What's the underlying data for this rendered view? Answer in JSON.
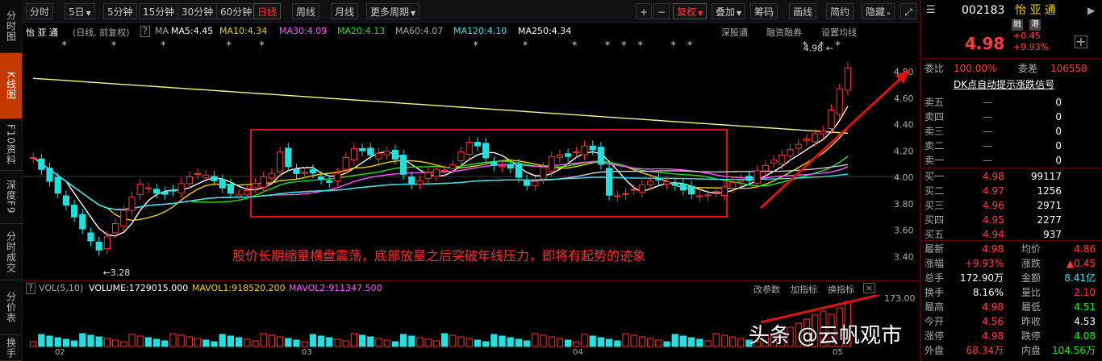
{
  "left_tabs": [
    {
      "label": "分时图"
    },
    {
      "label": "K线图"
    },
    {
      "label": "F10资料"
    },
    {
      "label": "深度F9"
    },
    {
      "label": "分时成交"
    },
    {
      "label": "分价表"
    },
    {
      "label": "换手"
    }
  ],
  "toolbar": {
    "periods": [
      "分时",
      "5日",
      "5分钟",
      "15分钟",
      "30分钟",
      "60分钟",
      "日线",
      "周线",
      "月线",
      "更多周期"
    ],
    "active_period": "日线",
    "plus": "+",
    "minus": "−",
    "adjust": "复权",
    "overlay": "叠加",
    "chips": "筹码",
    "draw": "画线",
    "simple": "简约",
    "hide": "隐藏"
  },
  "maininfo": {
    "name": "怡 亚 通",
    "mode": "(日线, 前复权)",
    "ma_label": "MA",
    "ma5": "MA5:4.45",
    "ma10": "MA10:4.34",
    "ma30": "MA30:4.09",
    "ma20": "MA20:4.13",
    "ma60": "MA60:4.07",
    "ma120": "MA120:4.10",
    "ma250": "MA250:4.34",
    "link1": "深股通",
    "link2": "融资融券",
    "link3": "设置均线"
  },
  "chart_data": {
    "type": "candlestick",
    "y_ticks": [
      "4.80",
      "4.60",
      "4.40",
      "4.20",
      "4.00",
      "3.80",
      "3.60",
      "3.40"
    ],
    "ylim": [
      3.22,
      5.05
    ],
    "x_ticks": [
      "02",
      "03",
      "04",
      "05"
    ],
    "low_mark": "3.28",
    "high_mark": "4.98",
    "vol_ticks": [
      "173.00"
    ]
  },
  "volinfo": {
    "label": "VOL(5,10)",
    "volume": "VOLUME:1729015.000",
    "mavol1": "MAVOL1:918520.200",
    "mavol2": "MAVOL2:911347.500",
    "change_param": "改参数",
    "add_indicator": "加指标",
    "swap_indicator": "换指标"
  },
  "annotation": "股价长期缩量横盘震荡，底部放量之后突破年线压力，即将有起势的迹象",
  "watermark": "头条 @云帆观市",
  "quote": {
    "code": "002183",
    "name": "怡 亚 通",
    "tag1": "融",
    "tag2": "港",
    "price": "4.98",
    "change": "+0.45",
    "pct": "+9.93%",
    "weibi_label": "委比",
    "weibi": "100.00%",
    "weicha_label": "委差",
    "weicha": "106558",
    "signal": "DK点自动提示涨跌信号",
    "sell": [
      {
        "label": "卖五",
        "price": "—",
        "vol": "0"
      },
      {
        "label": "卖四",
        "price": "—",
        "vol": "0"
      },
      {
        "label": "卖三",
        "price": "—",
        "vol": "0"
      },
      {
        "label": "卖二",
        "price": "—",
        "vol": "0"
      },
      {
        "label": "卖一",
        "price": "—",
        "vol": "0"
      }
    ],
    "buy": [
      {
        "label": "买一",
        "price": "4.98",
        "vol": "99117"
      },
      {
        "label": "买二",
        "price": "4.97",
        "vol": "1256"
      },
      {
        "label": "买三",
        "price": "4.96",
        "vol": "2971"
      },
      {
        "label": "买四",
        "price": "4.95",
        "vol": "2277"
      },
      {
        "label": "买五",
        "price": "4.94",
        "vol": "937"
      }
    ],
    "stats": [
      {
        "l1": "最新",
        "v1": "4.98",
        "l2": "均价",
        "v2": "4.86"
      },
      {
        "l1": "涨幅",
        "v1": "+9.93%",
        "l2": "涨跌",
        "v2": "▲0.45"
      },
      {
        "l1": "总手",
        "v1": "172.90万",
        "l2": "金额",
        "v2": "8.41亿"
      },
      {
        "l1": "换手",
        "v1": "8.16%",
        "l2": "量比",
        "v2": "2.10"
      },
      {
        "l1": "最高",
        "v1": "4.98",
        "l2": "最低",
        "v2": "4.51"
      },
      {
        "l1": "今开",
        "v1": "4.56",
        "l2": "昨收",
        "v2": "4.53"
      },
      {
        "l1": "涨停",
        "v1": "4.98",
        "l2": "跌停",
        "v2": "4.08"
      },
      {
        "l1": "外盘",
        "v1": "68.34万",
        "l2": "内盘",
        "v2": "104.56万"
      }
    ]
  }
}
